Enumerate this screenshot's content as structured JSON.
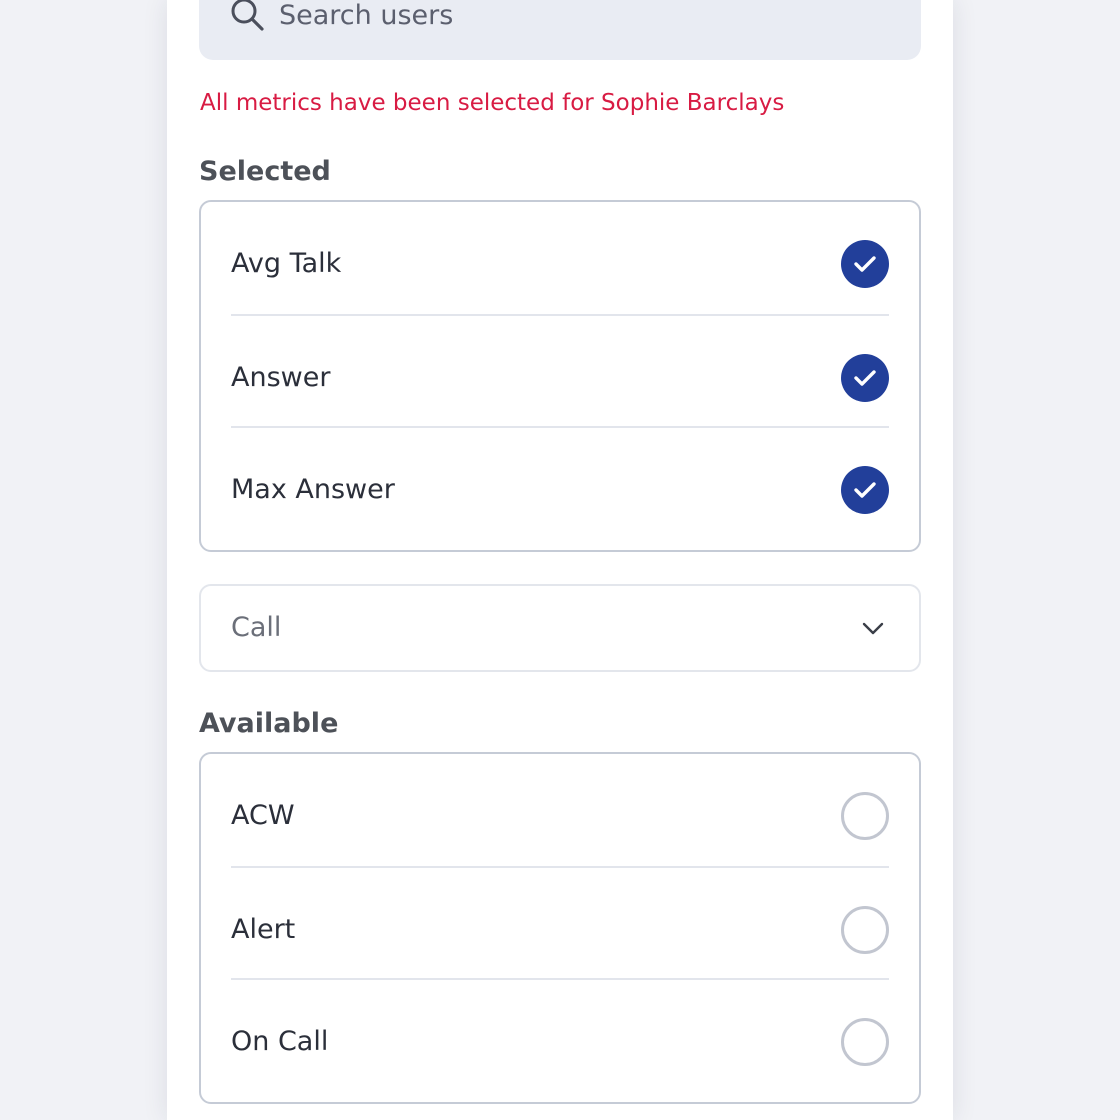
{
  "search": {
    "placeholder": "Search users"
  },
  "message": {
    "text": "All metrics have been selected for Sophie Barclays",
    "color": "#d81b43"
  },
  "selected": {
    "label": "Selected",
    "items": [
      {
        "label": "Avg Talk",
        "checked": true
      },
      {
        "label": "Answer",
        "checked": true
      },
      {
        "label": "Max Answer",
        "checked": true
      }
    ]
  },
  "category_dropdown": {
    "value": "Call"
  },
  "available": {
    "label": "Available",
    "items": [
      {
        "label": "ACW",
        "checked": false
      },
      {
        "label": "Alert",
        "checked": false
      },
      {
        "label": "On Call",
        "checked": false
      }
    ]
  },
  "colors": {
    "accent": "#223f9a",
    "error": "#d81b43",
    "panel_background": "#ffffff",
    "page_background": "#f1f2f6"
  }
}
